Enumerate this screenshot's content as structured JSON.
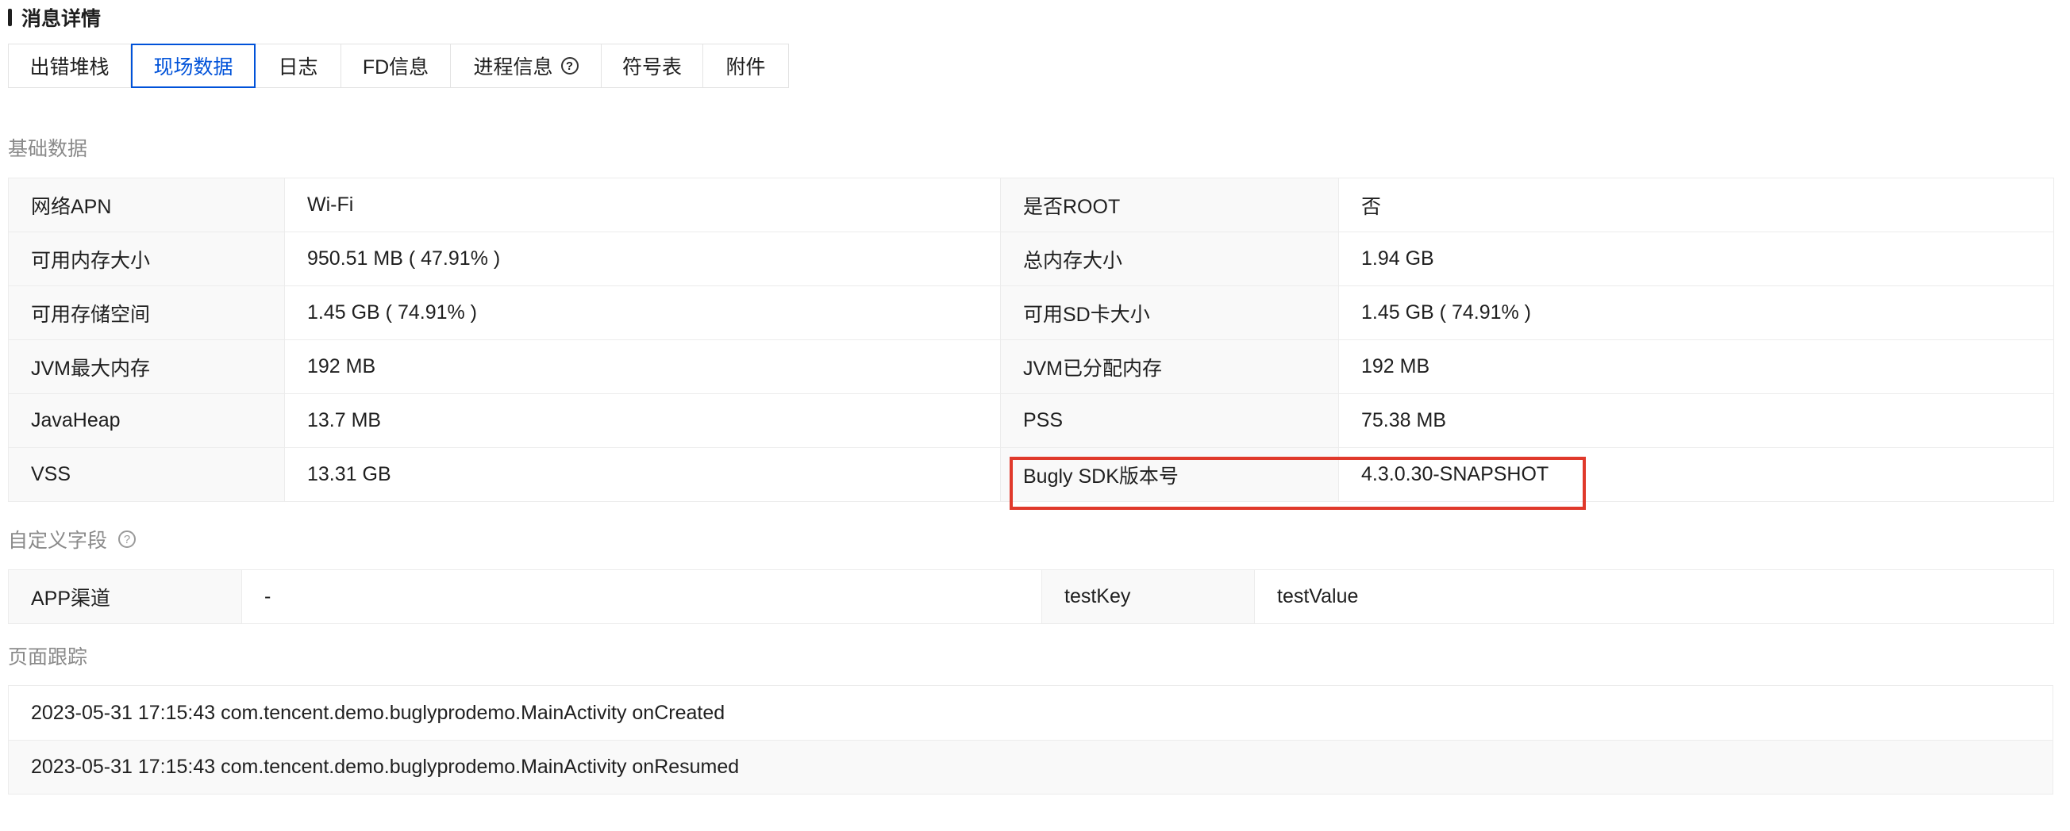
{
  "header": {
    "title": "消息详情"
  },
  "tabs": [
    {
      "label": "出错堆栈"
    },
    {
      "label": "现场数据",
      "active": true
    },
    {
      "label": "日志"
    },
    {
      "label": "FD信息"
    },
    {
      "label": "进程信息",
      "help_icon": "?"
    },
    {
      "label": "符号表"
    },
    {
      "label": "附件"
    }
  ],
  "basic": {
    "title": "基础数据",
    "rows": [
      {
        "k1": "网络APN",
        "v1": "Wi-Fi",
        "k2": "是否ROOT",
        "v2": "否"
      },
      {
        "k1": "可用内存大小",
        "v1": "950.51 MB ( 47.91% )",
        "k2": "总内存大小",
        "v2": "1.94 GB"
      },
      {
        "k1": "可用存储空间",
        "v1": "1.45 GB ( 74.91% )",
        "k2": "可用SD卡大小",
        "v2": "1.45 GB ( 74.91% )"
      },
      {
        "k1": "JVM最大内存",
        "v1": "192 MB",
        "k2": "JVM已分配内存",
        "v2": "192 MB"
      },
      {
        "k1": "JavaHeap",
        "v1": "13.7 MB",
        "k2": "PSS",
        "v2": "75.38 MB"
      },
      {
        "k1": "VSS",
        "v1": "13.31 GB",
        "k2": "Bugly SDK版本号",
        "v2": "4.3.0.30-SNAPSHOT"
      }
    ]
  },
  "custom": {
    "title": "自定义字段",
    "help_icon": "?",
    "rows": [
      {
        "k1": "APP渠道",
        "v1": "-",
        "k2": "testKey",
        "v2": "testValue"
      }
    ]
  },
  "trace": {
    "title": "页面跟踪",
    "items": [
      "2023-05-31 17:15:43 com.tencent.demo.buglyprodemo.MainActivity onCreated",
      "2023-05-31 17:15:43 com.tencent.demo.buglyprodemo.MainActivity onResumed"
    ]
  },
  "colors": {
    "accent": "#0052d9",
    "highlight": "#e0392b",
    "muted": "#8a8a8a"
  }
}
